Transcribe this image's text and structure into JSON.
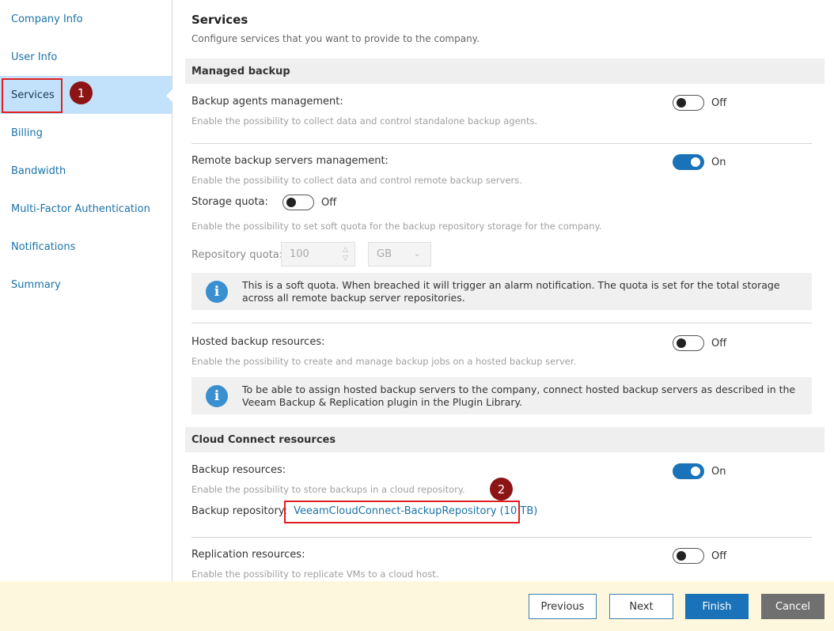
{
  "sidebar": {
    "items": [
      {
        "label": "Company Info"
      },
      {
        "label": "User Info"
      },
      {
        "label": "Services"
      },
      {
        "label": "Billing"
      },
      {
        "label": "Bandwidth"
      },
      {
        "label": "Multi-Factor Authentication"
      },
      {
        "label": "Notifications"
      },
      {
        "label": "Summary"
      }
    ],
    "active_index": 2
  },
  "callouts": {
    "one": "1",
    "two": "2"
  },
  "page": {
    "title": "Services",
    "subtitle": "Configure services that you want to provide to the company."
  },
  "managed_backup": {
    "header": "Managed backup",
    "agents": {
      "label": "Backup agents management:",
      "desc": "Enable the possibility to collect data and control standalone backup agents.",
      "state": "Off"
    },
    "remote": {
      "label": "Remote backup servers management:",
      "desc": "Enable the possibility to collect data and control remote backup servers.",
      "state": "On"
    },
    "storage_quota": {
      "label": "Storage quota:",
      "state": "Off",
      "desc": "Enable the possibility to set soft quota for the backup repository storage for the company."
    },
    "repository_quota": {
      "label": "Repository quota:",
      "value": "100",
      "unit": "GB"
    },
    "quota_info": "This is a soft quota. When breached it will trigger an alarm notification. The quota is set for the total storage across all remote backup server repositories.",
    "hosted": {
      "label": "Hosted backup resources:",
      "desc": "Enable the possibility to create and manage backup jobs on a hosted backup server.",
      "state": "Off"
    },
    "hosted_info": "To be able to assign hosted backup servers to the company, connect hosted backup servers as described in the Veeam Backup & Replication plugin in the Plugin Library."
  },
  "cloud_connect": {
    "header": "Cloud Connect resources",
    "backup": {
      "label": "Backup resources:",
      "desc": "Enable the possibility to store backups in a cloud repository.",
      "state": "On"
    },
    "repository": {
      "label": "Backup repository:",
      "link": "VeeamCloudConnect-BackupRepository (10 TB)"
    },
    "replication": {
      "label": "Replication resources:",
      "desc": "Enable the possibility to replicate VMs to a cloud host.",
      "state": "Off"
    }
  },
  "footer": {
    "previous": "Previous",
    "next": "Next",
    "finish": "Finish",
    "cancel": "Cancel"
  },
  "colors": {
    "accent": "#1a73b8",
    "active_nav": "#c2e1fa",
    "callout_red": "#e02020",
    "badge": "#8b1414",
    "footer_bg": "#fdf7dd"
  }
}
